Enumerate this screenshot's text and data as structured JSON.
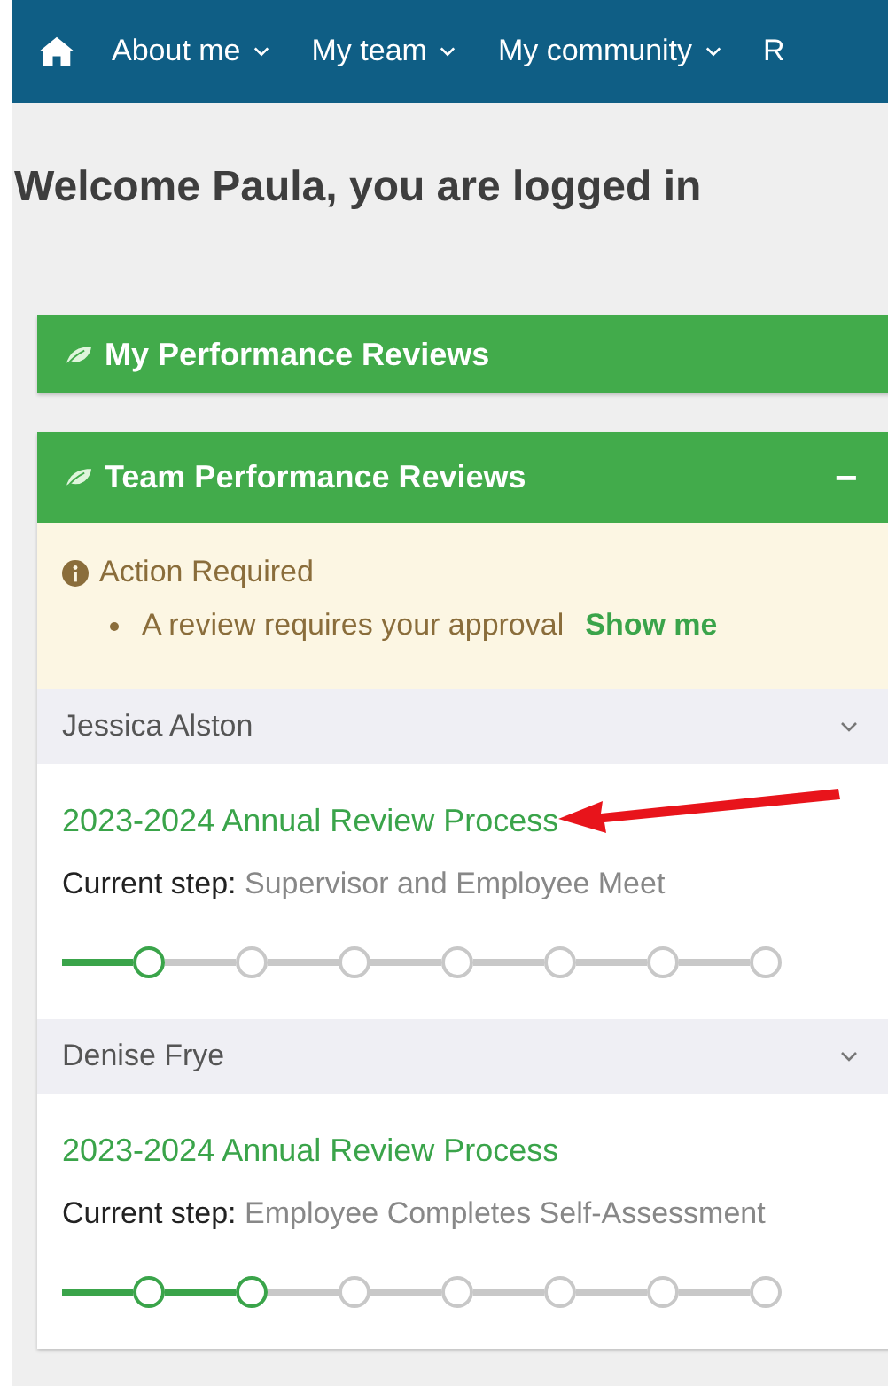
{
  "nav": {
    "items": [
      {
        "label": "About me",
        "dropdown": true
      },
      {
        "label": "My team",
        "dropdown": true
      },
      {
        "label": "My community",
        "dropdown": true
      },
      {
        "label": "R",
        "dropdown": false
      }
    ]
  },
  "heading": "Welcome Paula, you are logged in",
  "panels": [
    {
      "title": "My Performance Reviews",
      "expanded": false
    },
    {
      "title": "Team Performance Reviews",
      "expanded": true,
      "toggle": "−",
      "action": {
        "title": "Action Required",
        "message": "A review requires your approval",
        "link": "Show me"
      },
      "employees": [
        {
          "name": "Jessica Alston",
          "review": "2023-2024 Annual Review Process",
          "step_label": "Current step:",
          "step": "Supervisor and Employee Meet",
          "annotated": true,
          "steps": [
            {
              "done": true
            },
            {
              "done": false
            },
            {
              "done": false
            },
            {
              "done": false
            },
            {
              "done": false
            },
            {
              "done": false
            },
            {
              "done": false
            }
          ]
        },
        {
          "name": "Denise Frye",
          "review": "2023-2024 Annual Review Process",
          "step_label": "Current step:",
          "step": "Employee Completes Self-Assessment",
          "annotated": false,
          "steps": [
            {
              "done": true
            },
            {
              "done": true
            },
            {
              "done": false
            },
            {
              "done": false
            },
            {
              "done": false
            },
            {
              "done": false
            },
            {
              "done": false
            }
          ]
        }
      ]
    }
  ]
}
